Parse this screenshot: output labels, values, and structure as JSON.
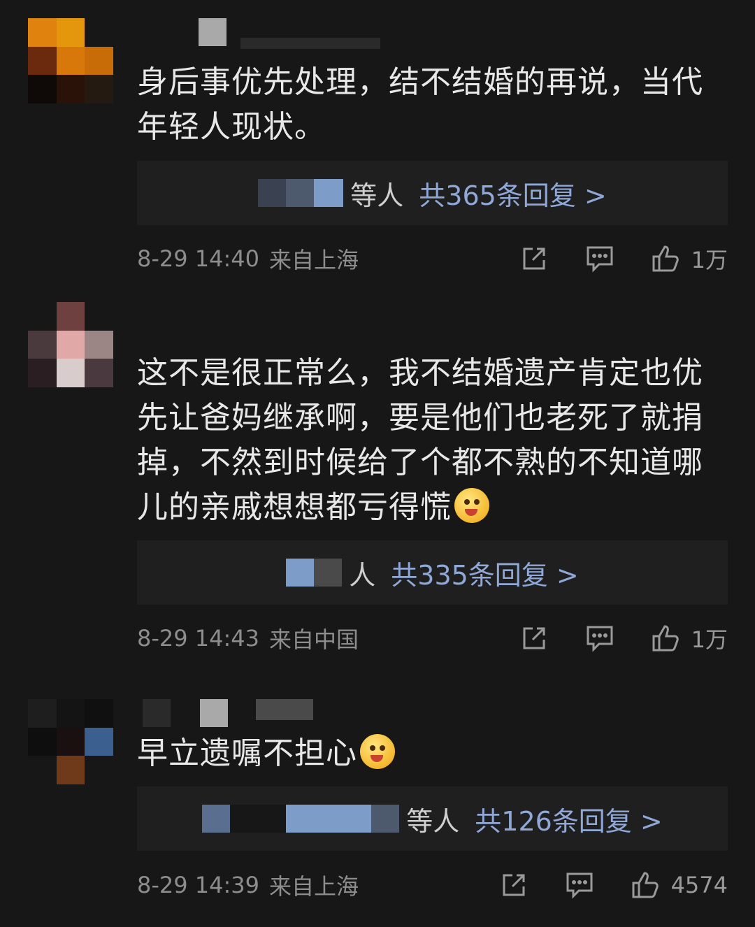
{
  "comments": [
    {
      "text": "身后事优先处理，结不结婚的再说，当代年轻人现状。",
      "reply_who": "等人",
      "reply_count": "共365条回复 >",
      "time": "8-29 14:40",
      "location": "来自上海",
      "likes": "1万"
    },
    {
      "text": "这不是很正常么，我不结婚遗产肯定也优先让爸妈继承啊，要是他们也老死了就捐掉，不然到时候给了个都不熟的不知道哪儿的亲戚想想都亏得慌",
      "reply_who": "人",
      "reply_count": "共335条回复 >",
      "time": "8-29 14:43",
      "location": "来自中国",
      "likes": "1万"
    },
    {
      "text": "早立遗嘱不担心",
      "reply_who": "等人",
      "reply_count": "共126条回复 >",
      "time": "8-29 14:39",
      "location": "来自上海",
      "likes": "4574"
    }
  ],
  "icons": {
    "share": "share-icon",
    "reply": "comment-icon",
    "like": "thumbs-up-icon"
  }
}
